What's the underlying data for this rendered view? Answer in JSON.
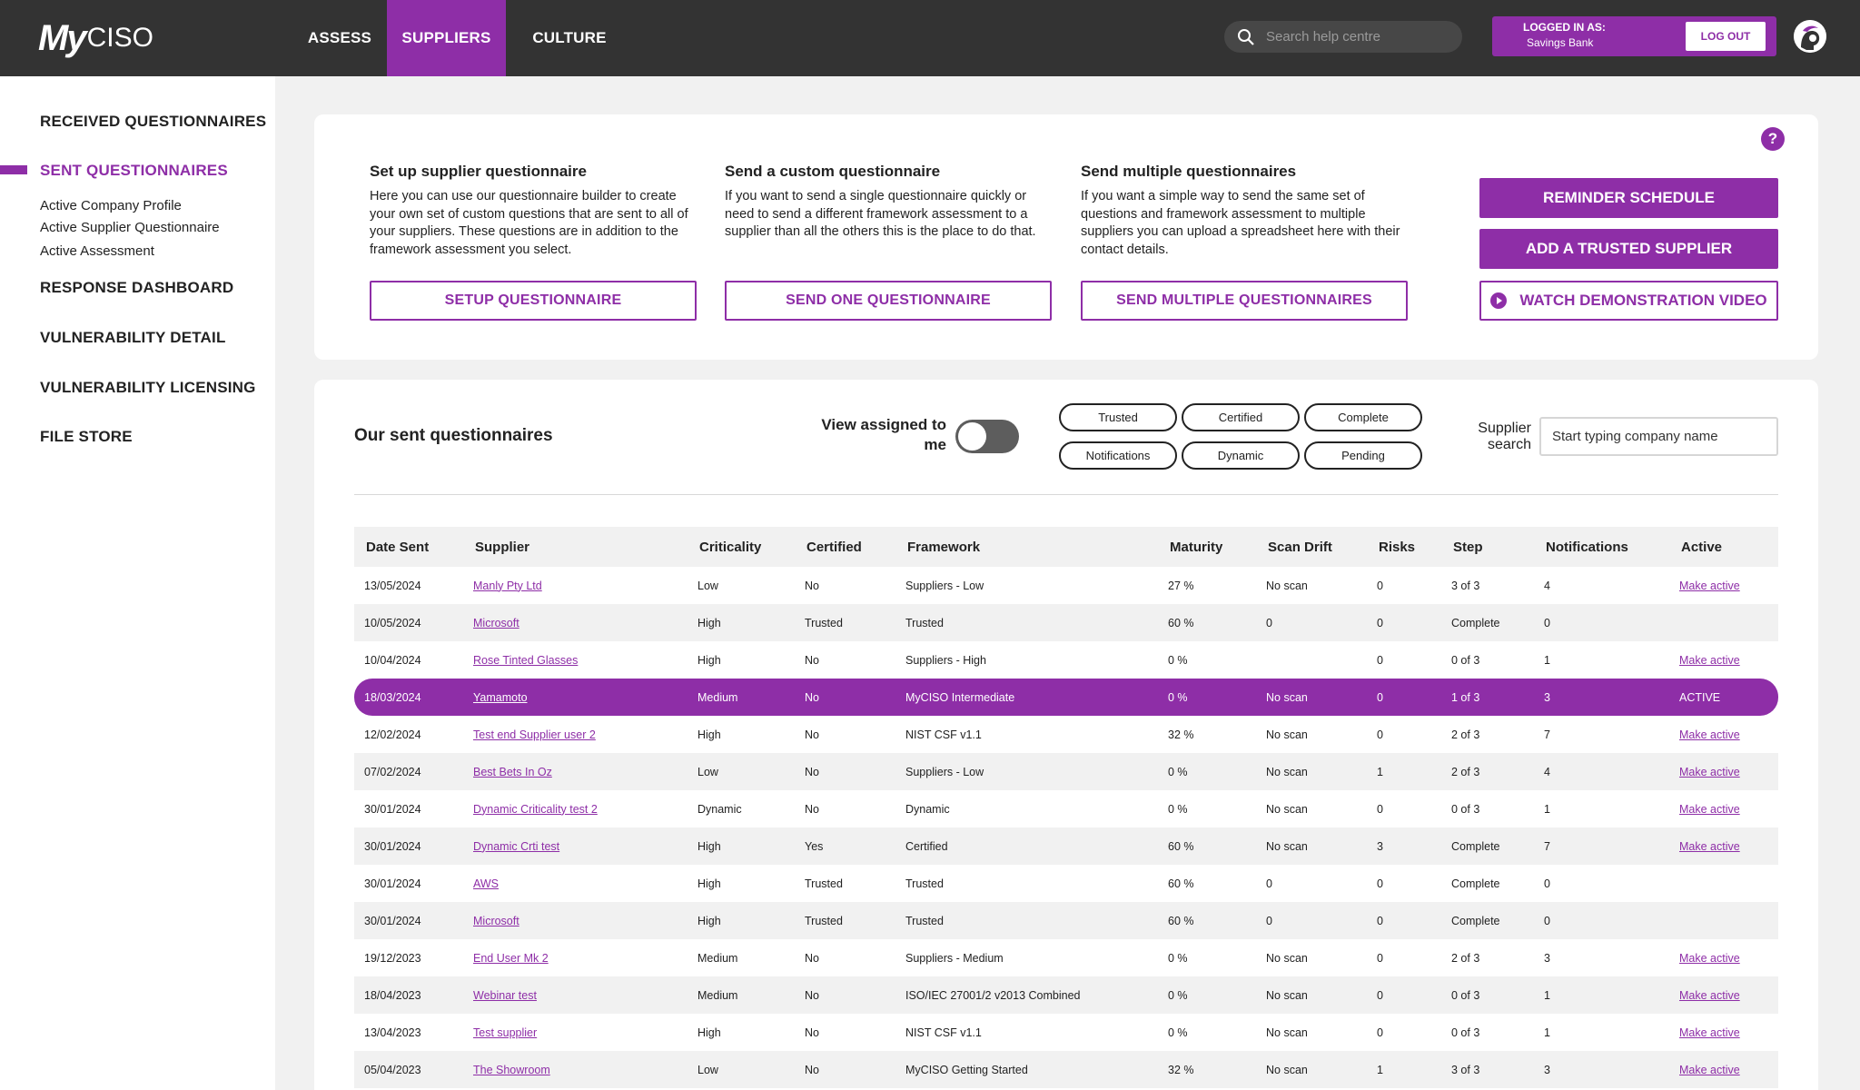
{
  "brand": {
    "logo_my": "My",
    "logo_ciso": "CISO"
  },
  "nav": {
    "items": [
      "ASSESS",
      "SUPPLIERS",
      "CULTURE"
    ]
  },
  "search": {
    "placeholder": "Search help centre"
  },
  "account": {
    "label": "LOGGED IN AS:",
    "user": "Savings Bank",
    "logout": "LOG OUT"
  },
  "sidebar": {
    "received": "RECEIVED QUESTIONNAIRES",
    "sent": "SENT QUESTIONNAIRES",
    "sub": [
      "Active Company Profile",
      "Active Supplier Questionnaire",
      "Active Assessment"
    ],
    "response": "RESPONSE DASHBOARD",
    "vuln_detail": "VULNERABILITY DETAIL",
    "vuln_licensing": "VULNERABILITY LICENSING",
    "file_store": "FILE STORE"
  },
  "intro": {
    "help": "?",
    "setup": {
      "title": "Set up supplier questionnaire",
      "text": "Here you can use our questionnaire builder to create your own set of custom questions that are sent to all of your suppliers. These questions are in addition to the framework assessment you select.",
      "button": "SETUP QUESTIONNAIRE"
    },
    "custom": {
      "title": "Send a custom questionnaire",
      "text": "If you want to send a single questionnaire quickly or need to send a different framework assessment to a supplier than all the others this is the place to do that.",
      "button": "SEND ONE QUESTIONNAIRE"
    },
    "multiple": {
      "title": "Send multiple questionnaires",
      "text": "If you want a simple way to send the same set of questions and framework assessment to multiple suppliers you can upload a spreadsheet here with their contact details.",
      "button": "SEND MULTIPLE QUESTIONNAIRES"
    },
    "reminder": "REMINDER SCHEDULE",
    "trusted": "ADD A TRUSTED SUPPLIER",
    "demo": "WATCH DEMONSTRATION VIDEO"
  },
  "sent": {
    "title": "Our sent questionnaires",
    "view_assigned": "View assigned to me",
    "filters": [
      "Trusted",
      "Certified",
      "Complete",
      "Notifications",
      "Dynamic",
      "Pending"
    ],
    "supplier_search_label": "Supplier search",
    "supplier_search_placeholder": "Start typing company name"
  },
  "table": {
    "headers": [
      "Date Sent",
      "Supplier",
      "Criticality",
      "Certified",
      "Framework",
      "Maturity",
      "Scan Drift",
      "Risks",
      "Step",
      "Notifications",
      "Active"
    ],
    "rows": [
      [
        "13/05/2024",
        "Manly Pty Ltd",
        "Low",
        "No",
        "Suppliers - Low",
        "27 %",
        "No scan",
        "0",
        "3 of 3",
        "4",
        "Make active"
      ],
      [
        "10/05/2024",
        "Microsoft",
        "High",
        "Trusted",
        "Trusted",
        "60 %",
        "0",
        "0",
        "Complete",
        "0",
        ""
      ],
      [
        "10/04/2024",
        "Rose Tinted Glasses",
        "High",
        "No",
        "Suppliers - High",
        "0 %",
        "",
        "0",
        "0 of 3",
        "1",
        "Make active"
      ],
      [
        "18/03/2024",
        "Yamamoto",
        "Medium",
        "No",
        "MyCISO Intermediate",
        "0 %",
        "No scan",
        "0",
        "1 of 3",
        "3",
        "ACTIVE"
      ],
      [
        "12/02/2024",
        "Test end Supplier user 2",
        "High",
        "No",
        "NIST CSF v1.1",
        "32 %",
        "No scan",
        "0",
        "2 of 3",
        "7",
        "Make active"
      ],
      [
        "07/02/2024",
        "Best Bets In Oz",
        "Low",
        "No",
        "Suppliers - Low",
        "0 %",
        "No scan",
        "1",
        "2 of 3",
        "4",
        "Make active"
      ],
      [
        "30/01/2024",
        "Dynamic Criticality test 2",
        "Dynamic",
        "No",
        "Dynamic",
        "0 %",
        "No scan",
        "0",
        "0 of 3",
        "1",
        "Make active"
      ],
      [
        "30/01/2024",
        "Dynamic Crti test",
        "High",
        "Yes",
        "Certified",
        "60 %",
        "No scan",
        "3",
        "Complete",
        "7",
        "Make active"
      ],
      [
        "30/01/2024",
        "AWS",
        "High",
        "Trusted",
        "Trusted",
        "60 %",
        "0",
        "0",
        "Complete",
        "0",
        ""
      ],
      [
        "30/01/2024",
        "Microsoft",
        "High",
        "Trusted",
        "Trusted",
        "60 %",
        "0",
        "0",
        "Complete",
        "0",
        ""
      ],
      [
        "19/12/2023",
        "End User Mk 2",
        "Medium",
        "No",
        "Suppliers - Medium",
        "0 %",
        "No scan",
        "0",
        "2 of 3",
        "3",
        "Make active"
      ],
      [
        "18/04/2023",
        "Webinar test",
        "Medium",
        "No",
        "ISO/IEC 27001/2 v2013 Combined",
        "0 %",
        "No scan",
        "0",
        "0 of 3",
        "1",
        "Make active"
      ],
      [
        "13/04/2023",
        "Test supplier",
        "High",
        "No",
        "NIST CSF v1.1",
        "0 %",
        "No scan",
        "0",
        "0 of 3",
        "1",
        "Make active"
      ],
      [
        "05/04/2023",
        "The Showroom",
        "Low",
        "No",
        "MyCISO Getting Started",
        "32 %",
        "No scan",
        "1",
        "3 of 3",
        "3",
        "Make active"
      ]
    ]
  },
  "colors": {
    "accent": "#8e2ea7",
    "topbar": "#333333",
    "background": "#f1f1f1"
  }
}
